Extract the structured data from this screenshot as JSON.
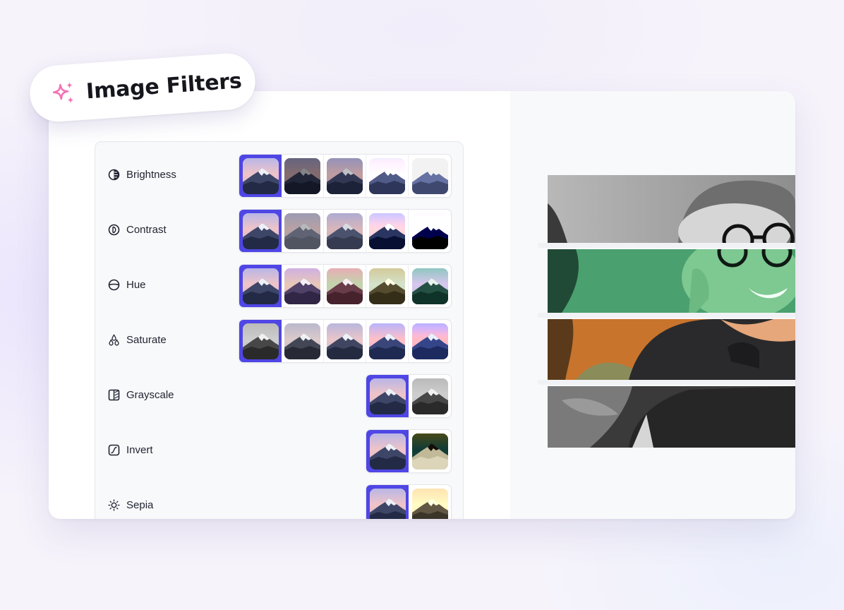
{
  "badge": {
    "title": "Image Filters",
    "icon": "sparkles-icon",
    "icon_color": "#f472b6"
  },
  "accent_color": "#4f46e5",
  "filters": [
    {
      "label": "Brightness",
      "icon": "brightness-icon",
      "options": 5,
      "selected_index": 0
    },
    {
      "label": "Contrast",
      "icon": "contrast-icon",
      "options": 5,
      "selected_index": 0
    },
    {
      "label": "Hue",
      "icon": "hue-icon",
      "options": 5,
      "selected_index": 0
    },
    {
      "label": "Saturate",
      "icon": "saturate-icon",
      "options": 5,
      "selected_index": 0
    },
    {
      "label": "Grayscale",
      "icon": "grayscale-icon",
      "options": 2,
      "selected_index": 0
    },
    {
      "label": "Invert",
      "icon": "invert-icon",
      "options": 2,
      "selected_index": 0
    },
    {
      "label": "Sepia",
      "icon": "sepia-icon",
      "options": 2,
      "selected_index": 0
    }
  ],
  "preview": {
    "strips": [
      "grayscale",
      "green-tint",
      "original",
      "dark"
    ]
  }
}
